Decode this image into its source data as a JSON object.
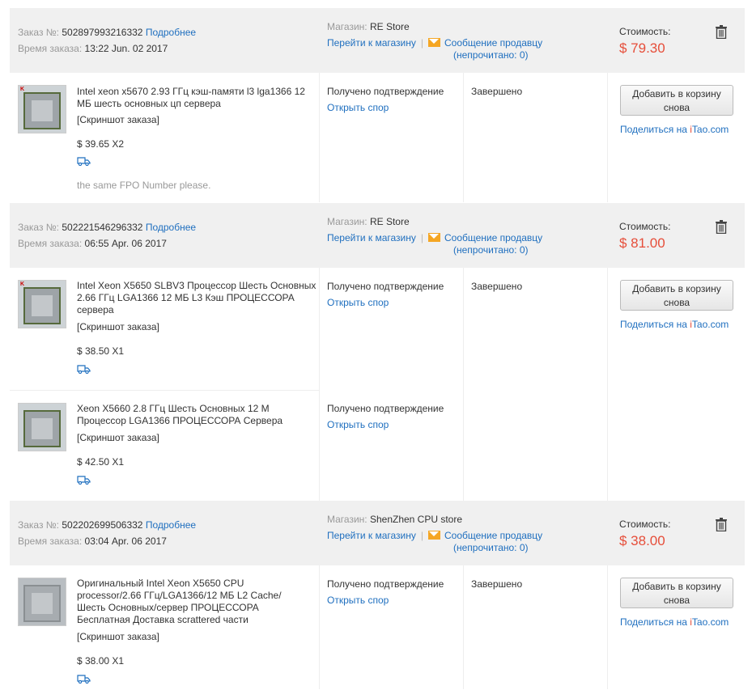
{
  "labels": {
    "order_no": "Заказ №:",
    "details": "Подробнее",
    "order_time": "Время заказа:",
    "store": "Магазин:",
    "go_to_store": "Перейти к магазину",
    "message_seller": "Сообщение продавцу",
    "unread": "(непрочитано: 0)",
    "cost": "Стоимость:",
    "snapshot": "[Скриншот заказа]",
    "received_confirmation": "Получено подтверждение",
    "open_dispute": "Открыть спор",
    "completed": "Завершено",
    "add_to_cart_again": "Добавить в корзину снова",
    "share_on": "Поделиться на ",
    "share_i": "i",
    "share_tao": "Tao.com"
  },
  "orders": [
    {
      "number": "502897993216332",
      "time": "13:22 Jun. 02 2017",
      "store": "RE Store",
      "cost": "$ 79.30",
      "items": [
        {
          "title": "Intel xeon x5670 2.93 ГГц кэш-памяти l3 lga1366 12 МБ шесть основных цп сервера",
          "price_qty": "$ 39.65 X2",
          "note": "the same FPO Number please."
        }
      ]
    },
    {
      "number": "502221546296332",
      "time": "06:55 Apr. 06 2017",
      "store": "RE Store",
      "cost": "$ 81.00",
      "items": [
        {
          "title": "Intel Xeon X5650 SLBV3 Процессор Шесть Основных 2.66 ГГц LGA1366 12 МБ L3 Кэш ПРОЦЕССОРА сервера",
          "price_qty": "$ 38.50 X1"
        },
        {
          "title": "Xeon X5660 2.8 ГГц Шесть Основных 12 M Процессор LGA1366 ПРОЦЕССОРА Сервера",
          "price_qty": "$ 42.50 X1"
        }
      ]
    },
    {
      "number": "502202699506332",
      "time": "03:04 Apr. 06 2017",
      "store": "ShenZhen CPU store",
      "cost": "$ 38.00",
      "items": [
        {
          "title": "Оригинальный Intel Xeon X5650 CPU processor/2.66 ГГц/LGA1366/12 МБ L2 Cache/ Шесть Основных/сервер ПРОЦЕССОРА Бесплатная Доставка scrattered части",
          "price_qty": "$ 38.00 X1"
        }
      ]
    }
  ],
  "colors": {
    "accent_link": "#1f6fbf",
    "price": "#e64e3a",
    "header_bg": "#f0f0f0",
    "mail_icon": "#f5a623"
  }
}
